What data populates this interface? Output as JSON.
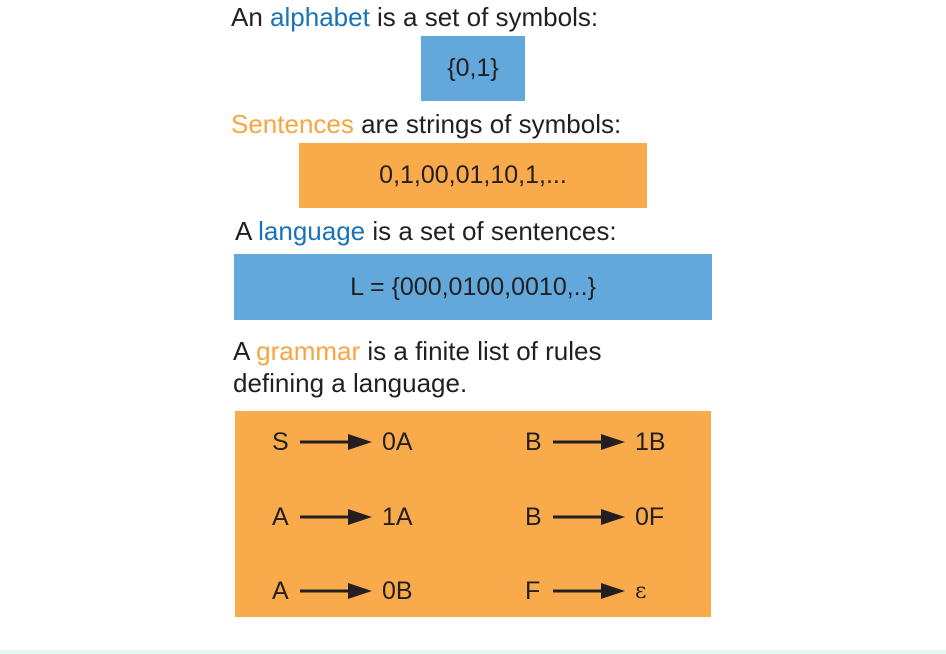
{
  "alphabet": {
    "prefix": "An ",
    "keyword": "alphabet",
    "suffix": " is a set of symbols:",
    "example": "{0,1}"
  },
  "sentences": {
    "keyword": "Sentences",
    "suffix": " are strings of symbols:",
    "example": "0,1,00,01,10,1,..."
  },
  "language": {
    "prefix": "A ",
    "keyword": "language",
    "suffix": " is a set of sentences:",
    "example": "L = {000,0100,0010,..}"
  },
  "grammar": {
    "prefix": "A ",
    "keyword": "grammar",
    "suffix": " is a finite list of rules",
    "line2": "defining a language.",
    "rules": [
      {
        "lhs": "S",
        "rhs": "0A"
      },
      {
        "lhs": "B",
        "rhs": "1B"
      },
      {
        "lhs": "A",
        "rhs": "1A"
      },
      {
        "lhs": "B",
        "rhs": "0F"
      },
      {
        "lhs": "A",
        "rhs": "0B"
      },
      {
        "lhs": "F",
        "rhs": "ε"
      }
    ]
  },
  "colors": {
    "keyword_blue": "#1a73b8",
    "keyword_orange": "#f7a540",
    "box_blue": "#62a8db",
    "box_orange": "#f9ab4b",
    "text": "#231f20"
  }
}
